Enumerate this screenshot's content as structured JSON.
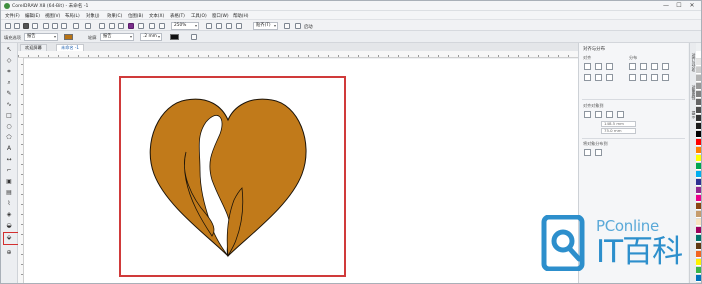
{
  "window": {
    "title": "CorelDRAW X8 (64-Bit) - 未命名 -1",
    "controls": [
      "—",
      "☐",
      "✕"
    ]
  },
  "menu": {
    "items": [
      "文件(F)",
      "编辑(E)",
      "视图(V)",
      "布局(L)",
      "对象(J)",
      "效果(C)",
      "位图(B)",
      "文本(X)",
      "表格(T)",
      "工具(O)",
      "窗口(W)",
      "帮助(H)"
    ]
  },
  "toolbar": {
    "zoom_value": "250%",
    "snap_label": "贴齐(T)",
    "launch_label": "启动"
  },
  "property_bar": {
    "fill_label": "填充选项",
    "fill_mode": "报告",
    "outline_label": "轮廓",
    "outline_mode": "报告",
    "outline_width": ".2 mm",
    "fill_color": "#b87314",
    "outline_color": "#111111"
  },
  "tabs": {
    "welcome": "欢迎屏幕",
    "document": "未命名 -1"
  },
  "canvas": {
    "highlight_color": "#d03a3a",
    "heart_fill": "#c17a1a",
    "heart_stroke": "#1a1208"
  },
  "docker": {
    "title": "对齐与分布",
    "align_label": "对齐",
    "distribute_label": "分布",
    "align_to_label": "对齐对象到",
    "field_x": "148.5 mm",
    "field_y": "75.0 mm",
    "distribute_to_label": "将对象分布到",
    "side_tabs": [
      "对齐与分布",
      "对象属性",
      "提示"
    ]
  },
  "palette": {
    "colors": [
      "#ffffff",
      "#e6e6e6",
      "#cccccc",
      "#b3b3b3",
      "#999999",
      "#808080",
      "#666666",
      "#4d4d4d",
      "#333333",
      "#1a1a1a",
      "#000000",
      "#ff0000",
      "#ff7f00",
      "#ffff00",
      "#00a651",
      "#00aeef",
      "#2e3192",
      "#92278f",
      "#ec008c",
      "#8b4513",
      "#c69c6d",
      "#f7e4c1",
      "#9e005d",
      "#00746b",
      "#603913",
      "#f26522",
      "#fff200",
      "#39b54a",
      "#0072bc"
    ]
  },
  "watermark": {
    "top_text": "PConline",
    "bottom_text": "IT百科",
    "logo_color": "#2d8fcc"
  }
}
